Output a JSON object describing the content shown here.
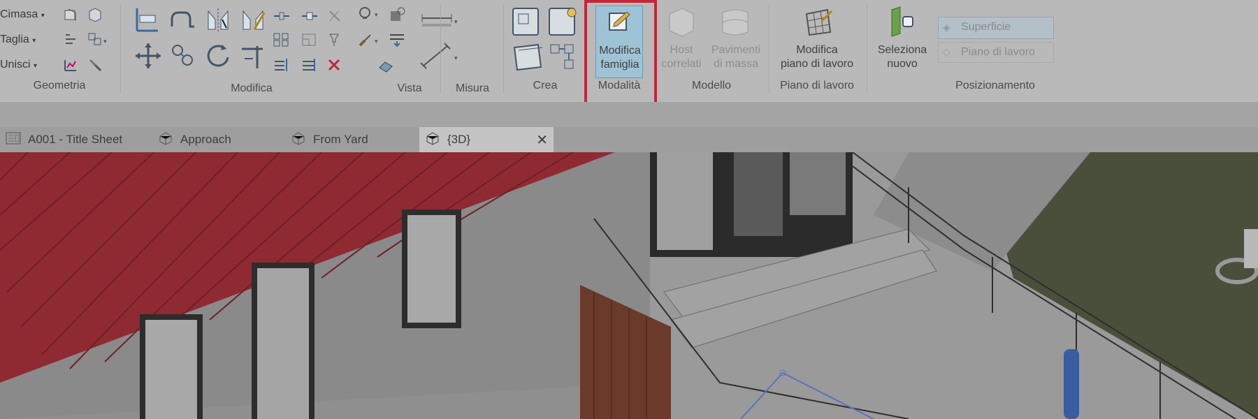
{
  "ribbon": {
    "geometria": {
      "items": [
        "Cimasa",
        "Taglia",
        "Unisci"
      ],
      "label": "Geometria"
    },
    "modifica": {
      "label": "Modifica"
    },
    "vista": {
      "label": "Vista"
    },
    "misura": {
      "label": "Misura"
    },
    "crea": {
      "label": "Crea"
    },
    "modalita": {
      "button_line1": "Modifica",
      "button_line2": "famiglia",
      "label": "Modalità"
    },
    "modello": {
      "host_line1": "Host",
      "host_line2": "correlati",
      "pavimenti_line1": "Pavimenti",
      "pavimenti_line2": "di massa",
      "label": "Modello"
    },
    "piano_di_lavoro": {
      "button_line1": "Modifica",
      "button_line2": "piano di lavoro",
      "label": "Piano di lavoro"
    },
    "seleziona": {
      "button_line1": "Seleziona",
      "button_line2": "nuovo"
    },
    "posizionamento": {
      "superficie": "Superficie",
      "piano": "Piano di lavoro",
      "label": "Posizionamento"
    }
  },
  "tabs": [
    {
      "label": "A001 - Title Sheet",
      "icon": "sheet-icon"
    },
    {
      "label": "Approach",
      "icon": "view-3d-icon"
    },
    {
      "label": "From Yard",
      "icon": "view-3d-icon"
    },
    {
      "label": "{3D}",
      "icon": "view-3d-icon",
      "active": true
    }
  ],
  "tab_close": "✕",
  "colors": {
    "highlight": "#c0283a",
    "roof": "#a52a33",
    "ribbon_bg": "#b9b9b9"
  }
}
